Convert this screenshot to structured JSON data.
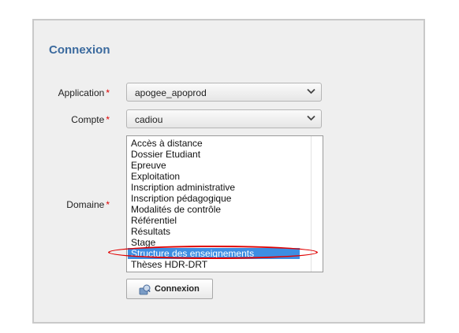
{
  "form": {
    "title": "Connexion",
    "required_marker": "*",
    "application": {
      "label": "Application",
      "value": "apogee_apoprod"
    },
    "compte": {
      "label": "Compte",
      "value": "cadiou"
    },
    "domaine": {
      "label": "Domaine",
      "options": [
        "Accès à distance",
        "Dossier Etudiant",
        "Epreuve",
        "Exploitation",
        "Inscription administrative",
        "Inscription pédagogique",
        "Modalités de contrôle",
        "Référentiel",
        "Résultats",
        "Stage",
        "Structure des enseignements",
        "Thèses HDR-DRT"
      ],
      "selected": "Structure des enseignements"
    },
    "submit_label": "Connexion"
  },
  "colors": {
    "title": "#3b6a9e",
    "required": "#dd0000",
    "selection": "#3d8ee3",
    "highlight_ellipse": "#e00000"
  },
  "icons": {
    "select_arrow": "chevron-down-icon",
    "submit": "login-icon"
  }
}
